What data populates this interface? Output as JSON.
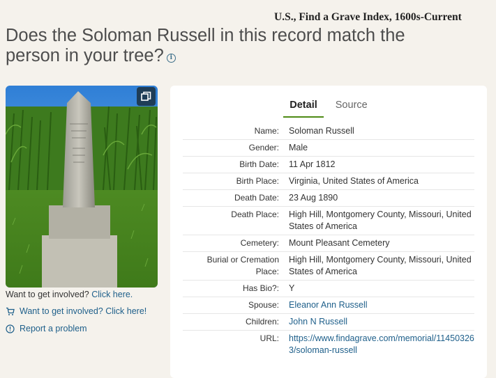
{
  "collection": {
    "title": "U.S., Find a Grave Index, 1600s-Current"
  },
  "header": {
    "title": "Does the Soloman Russell in this record match the person in your tree?",
    "info_icon": "info-icon"
  },
  "photo": {
    "alt_icon": "headstone-photo",
    "expand_icon": "expand-icon"
  },
  "left": {
    "involve_text": "Want to get involved?",
    "involve_link": "Click here.",
    "cart_link": "Want to get involved? Click here!",
    "report_link": "Report a problem"
  },
  "tabs": [
    {
      "label": "Detail",
      "active": true
    },
    {
      "label": "Source",
      "active": false
    }
  ],
  "record": [
    {
      "label": "Name:",
      "value": "Soloman Russell",
      "link": false
    },
    {
      "label": "Gender:",
      "value": "Male",
      "link": false
    },
    {
      "label": "Birth Date:",
      "value": "11 Apr 1812",
      "link": false
    },
    {
      "label": "Birth Place:",
      "value": "Virginia, United States of America",
      "link": false
    },
    {
      "label": "Death Date:",
      "value": "23 Aug 1890",
      "link": false
    },
    {
      "label": "Death Place:",
      "value": "High Hill, Montgomery County, Missouri, United States of America",
      "link": false
    },
    {
      "label": "Cemetery:",
      "value": "Mount Pleasant Cemetery",
      "link": false
    },
    {
      "label": "Burial or Cremation Place:",
      "value": "High Hill, Montgomery County, Missouri, United States of America",
      "link": false
    },
    {
      "label": "Has Bio?:",
      "value": "Y",
      "link": false
    },
    {
      "label": "Spouse:",
      "value": "Eleanor Ann Russell",
      "link": true
    },
    {
      "label": "Children:",
      "value": "John N Russell",
      "link": true
    },
    {
      "label": "URL:",
      "value": "https://www.findagrave.com/memorial/114503263/soloman-russell",
      "link": true
    }
  ],
  "colors": {
    "background": "#f5f2ec",
    "link": "#1e5f8a",
    "tab_underline": "#4d8a14",
    "expand_button": "#1f3d57"
  }
}
